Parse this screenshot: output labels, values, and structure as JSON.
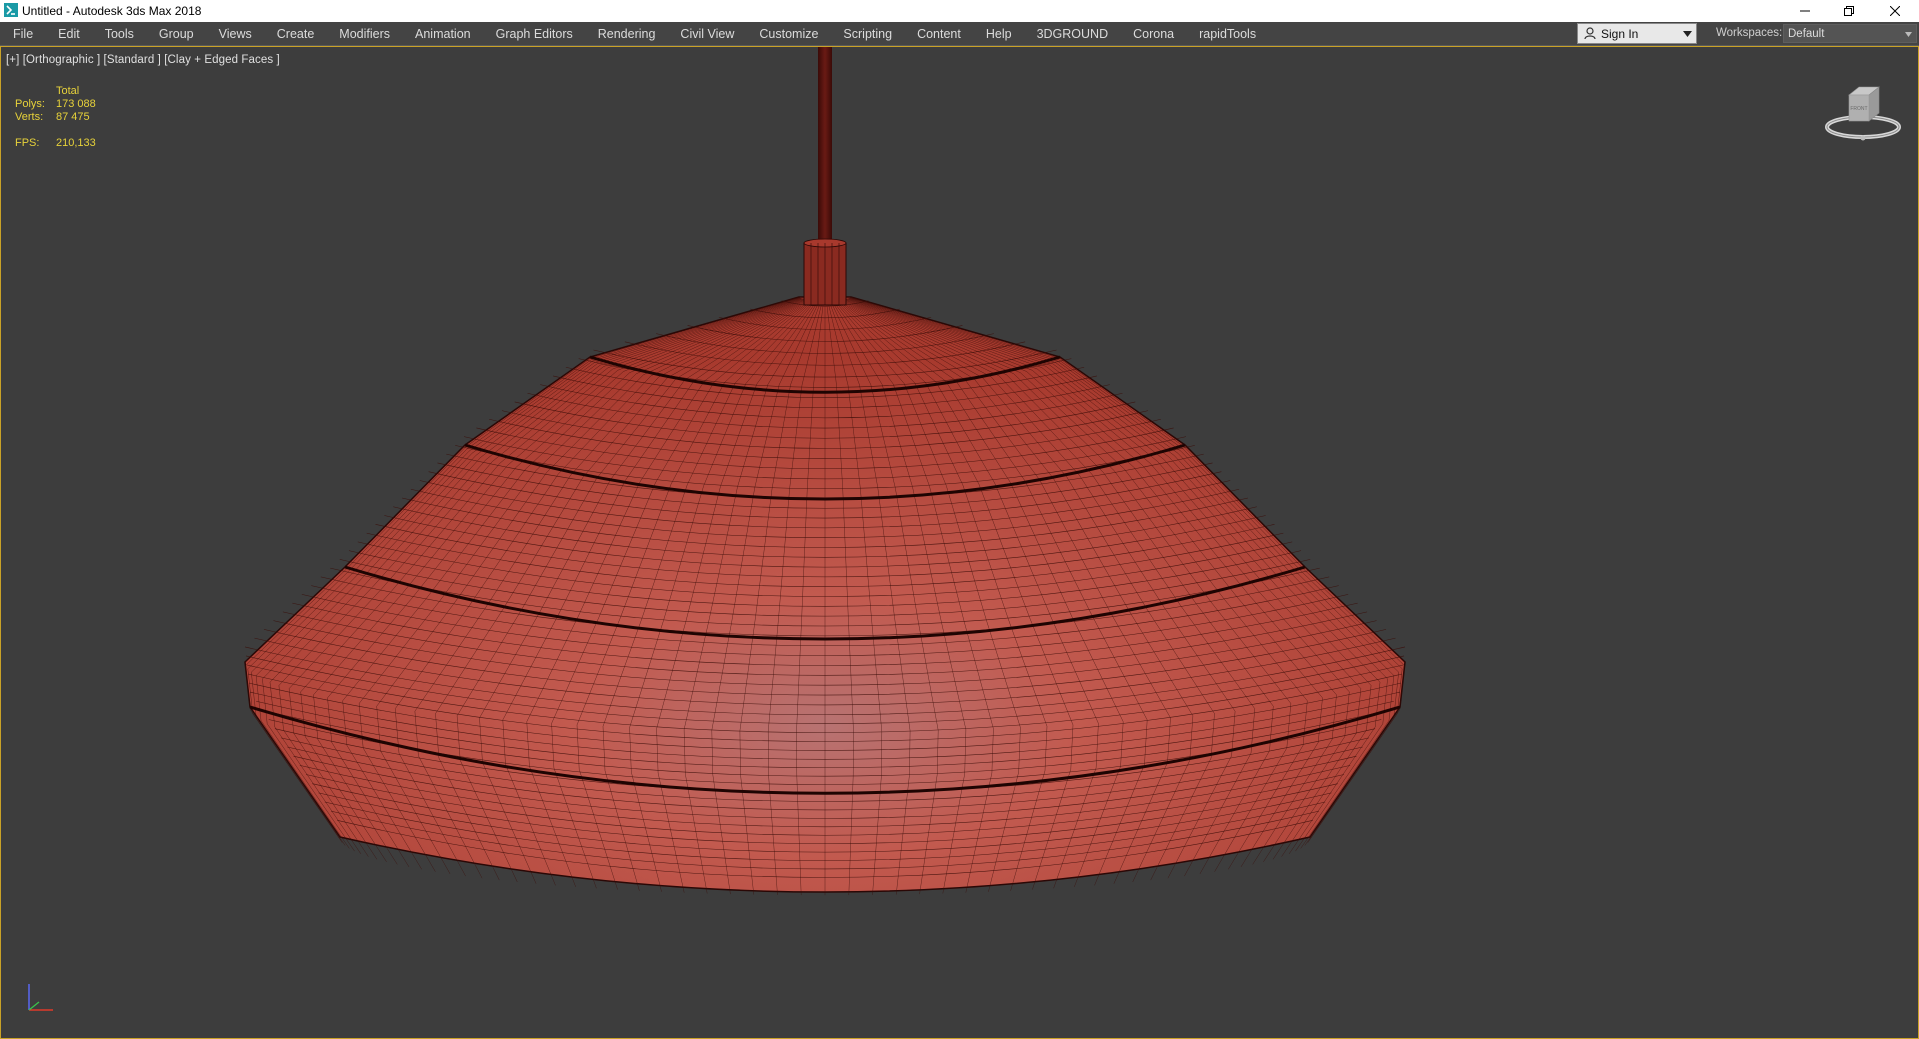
{
  "window": {
    "title": "Untitled - Autodesk 3ds Max 2018",
    "app_icon": "3dsmax-icon",
    "controls": [
      "minimize-icon",
      "restore-icon",
      "close-icon"
    ]
  },
  "menubar": {
    "items": [
      {
        "label": "File"
      },
      {
        "label": "Edit"
      },
      {
        "label": "Tools"
      },
      {
        "label": "Group"
      },
      {
        "label": "Views"
      },
      {
        "label": "Create"
      },
      {
        "label": "Modifiers"
      },
      {
        "label": "Animation"
      },
      {
        "label": "Graph Editors"
      },
      {
        "label": "Rendering"
      },
      {
        "label": "Civil View"
      },
      {
        "label": "Customize"
      },
      {
        "label": "Scripting"
      },
      {
        "label": "Content"
      },
      {
        "label": "Help"
      },
      {
        "label": "3DGROUND"
      },
      {
        "label": "Corona"
      },
      {
        "label": "rapidTools"
      }
    ],
    "signin_label": "Sign In",
    "workspaces_label": "Workspaces:",
    "workspace_value": "Default"
  },
  "viewport": {
    "label": "[+] [Orthographic ] [Standard ] [Clay + Edged Faces ]",
    "stats": {
      "header": "Total",
      "polys_label": "Polys:",
      "polys_value": "173 088",
      "verts_label": "Verts:",
      "verts_value": "87 475",
      "fps_label": "FPS:",
      "fps_value": "210,133"
    },
    "viewcube_face": "FRONT"
  },
  "colors": {
    "accent": "#c9a227",
    "stats_text": "#e7d23a",
    "viewport_bg": "#3d3d3d",
    "clay": "#c84c3e",
    "wire": "#3a0d08"
  }
}
